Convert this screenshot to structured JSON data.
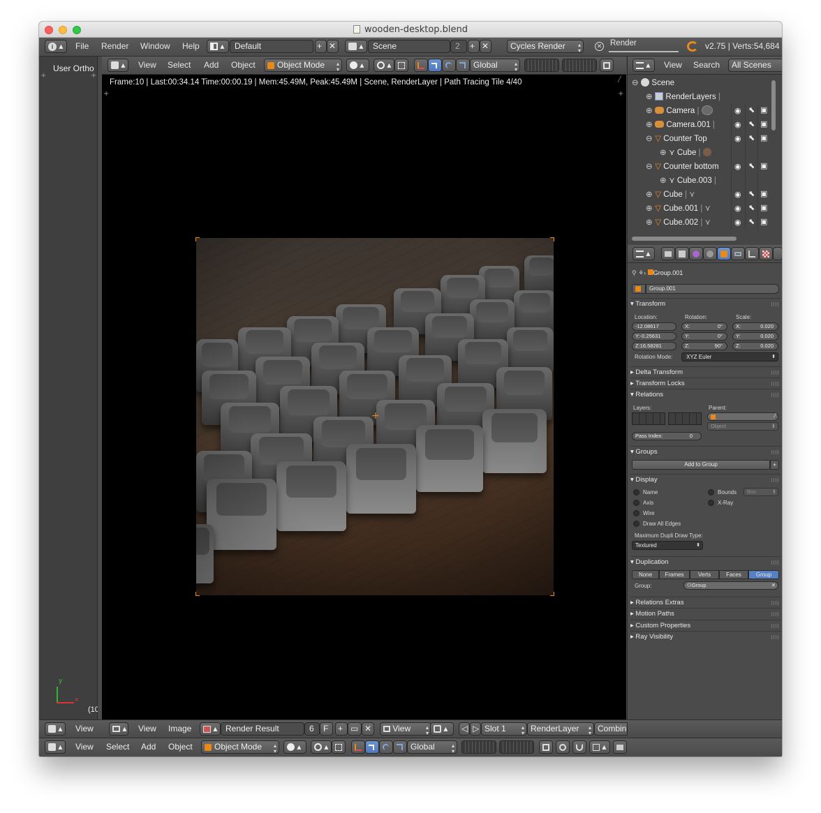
{
  "window": {
    "title": "wooden-desktop.blend"
  },
  "info_header": {
    "menus": [
      "File",
      "Render",
      "Window",
      "Help"
    ],
    "screen_layout": "Default",
    "scene": "Scene",
    "scene_users": "2",
    "engine": "Cycles Render",
    "render_label": "Render",
    "stats": "v2.75 | Verts:54,684"
  },
  "left_pane": {
    "label": "User Ortho",
    "frame_label": "(10"
  },
  "viewport_header": {
    "menus": [
      "View",
      "Select",
      "Add",
      "Object"
    ],
    "mode": "Object Mode",
    "orientation": "Global"
  },
  "render_info": {
    "text": "Frame:10 | Last:00:34.14 Time:00:00.19 | Mem:45.49M, Peak:45.49M | Scene, RenderLayer | Path Tracing Tile 4/40"
  },
  "outliner": {
    "menus": [
      "View",
      "Search"
    ],
    "filter": "All Scenes",
    "rows": [
      {
        "label": "Scene"
      },
      {
        "label": "RenderLayers"
      },
      {
        "label": "Camera"
      },
      {
        "label": "Camera.001"
      },
      {
        "label": "Counter Top"
      },
      {
        "label": "Cube"
      },
      {
        "label": "Counter bottom"
      },
      {
        "label": "Cube.003"
      },
      {
        "label": "Cube"
      },
      {
        "label": "Cube.001"
      },
      {
        "label": "Cube.002"
      }
    ]
  },
  "properties": {
    "breadcrumb": "Group.001",
    "object_name": "Group.001",
    "transform": {
      "title": "Transform",
      "location_label": "Location:",
      "rotation_label": "Rotation:",
      "scale_label": "Scale:",
      "location": [
        "-12.08617",
        "Y:-0.25631",
        "Z:16.58281"
      ],
      "rotation": [
        "X:",
        "Y:",
        "Z:"
      ],
      "rotation_values": [
        "0°",
        "0°",
        "90°"
      ],
      "scale": [
        "X:",
        "Y:",
        "Z:"
      ],
      "scale_values": [
        "0.020",
        "0.020",
        "0.020"
      ],
      "rotation_mode_label": "Rotation Mode:",
      "rotation_mode": "XYZ Euler"
    },
    "delta": "Delta Transform",
    "locks": "Transform Locks",
    "relations": {
      "title": "Relations",
      "layers_label": "Layers:",
      "parent_label": "Parent:",
      "parent_type": "Object",
      "pass_index_label": "Pass Index:",
      "pass_index": "0"
    },
    "groups": {
      "title": "Groups",
      "add": "Add to Group"
    },
    "display": {
      "title": "Display",
      "name": "Name",
      "axis": "Axis",
      "wire": "Wire",
      "draw_all_edges": "Draw All Edges",
      "bounds": "Bounds",
      "bounds_type": "Box",
      "xray": "X-Ray",
      "max_dupli_label": "Maximum Dupli Draw Type:",
      "max_dupli": "Textured"
    },
    "duplication": {
      "title": "Duplication",
      "tabs": [
        "None",
        "Frames",
        "Verts",
        "Faces",
        "Group"
      ],
      "active": "Group",
      "group_label": "Group:",
      "group_value": "Group"
    },
    "collapsed": [
      "Relations Extras",
      "Motion Paths",
      "Custom Properties",
      "Ray Visibility"
    ]
  },
  "image_header": {
    "view": "View",
    "image": "Image",
    "image_name": "Render Result",
    "users": "6",
    "fake": "F",
    "view2": "View",
    "slot": "Slot 1",
    "layer": "RenderLayer",
    "pass": "Combin"
  },
  "bottom_header": {
    "view": "View",
    "menus": [
      "View",
      "Select",
      "Add",
      "Object"
    ],
    "mode": "Object Mode",
    "orientation": "Global"
  },
  "colors": {
    "accent": "#5680c2",
    "orange": "#e8891a"
  }
}
